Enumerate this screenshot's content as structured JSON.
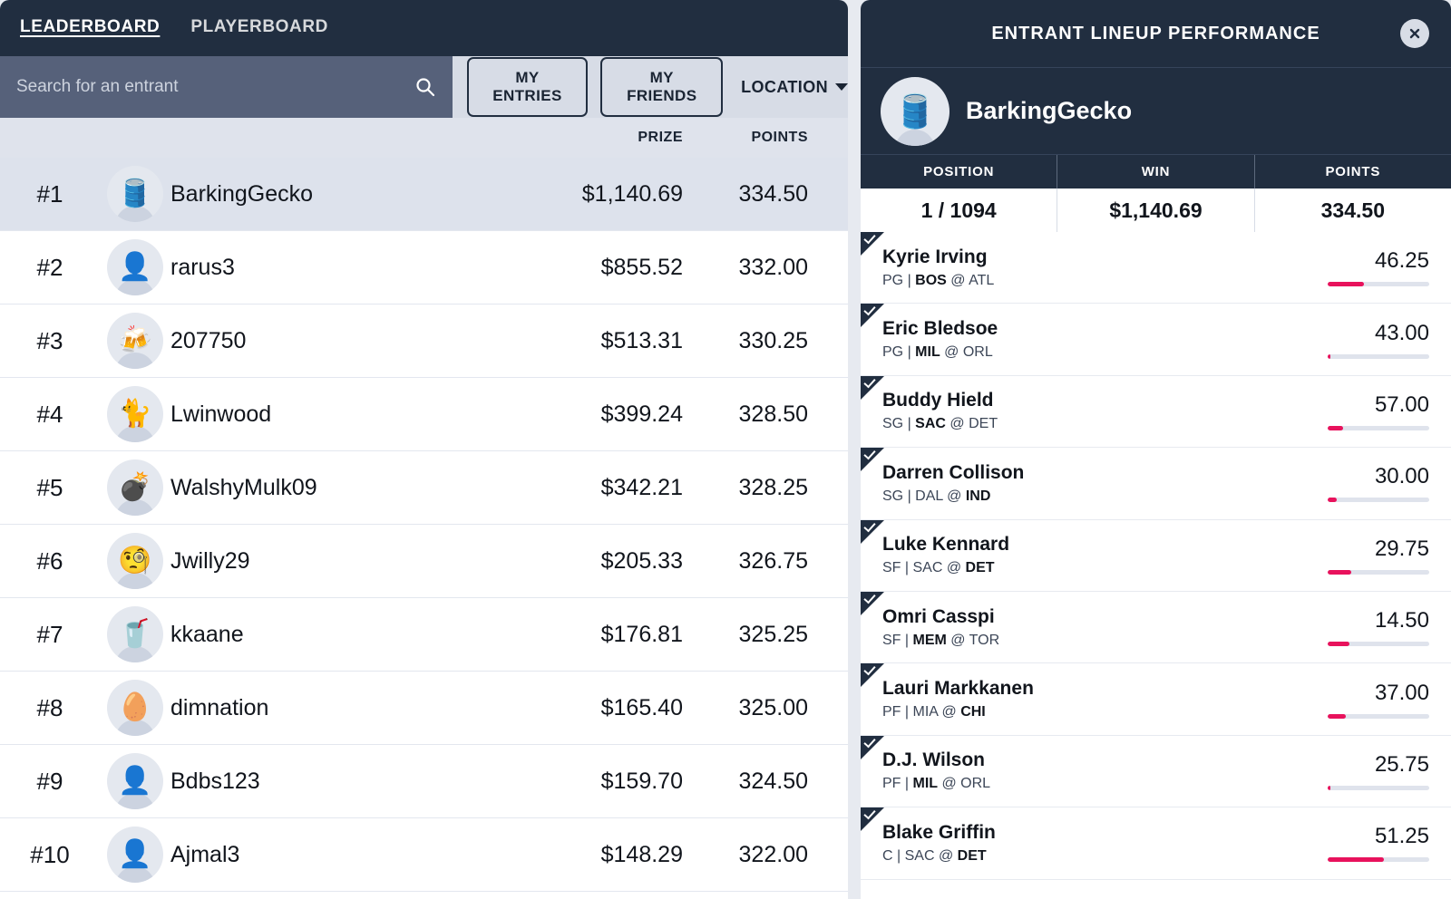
{
  "leaderboard": {
    "tabs": [
      {
        "label": "LEADERBOARD",
        "active": true
      },
      {
        "label": "PLAYERBOARD",
        "active": false
      }
    ],
    "search": {
      "placeholder": "Search for an entrant",
      "value": ""
    },
    "filters": {
      "my_entries": "MY ENTRIES",
      "my_friends": "MY FRIENDS",
      "location": "LOCATION"
    },
    "columns": {
      "prize": "PRIZE",
      "points": "POINTS"
    },
    "rows": [
      {
        "rank": "#1",
        "name": "BarkingGecko",
        "prize": "$1,140.69",
        "points": "334.50",
        "avatar": "oil-drum-avatar",
        "emoji": "🛢️",
        "selected": true
      },
      {
        "rank": "#2",
        "name": "rarus3",
        "prize": "$855.52",
        "points": "332.00",
        "avatar": "photo-avatar",
        "emoji": "👤",
        "selected": false
      },
      {
        "rank": "#3",
        "name": "207750",
        "prize": "$513.31",
        "points": "330.25",
        "avatar": "beer-mugs-avatar",
        "emoji": "🍻",
        "selected": false
      },
      {
        "rank": "#4",
        "name": "Lwinwood",
        "prize": "$399.24",
        "points": "328.50",
        "avatar": "animal-photo-avatar",
        "emoji": "🐈",
        "selected": false
      },
      {
        "rank": "#5",
        "name": "WalshyMulk09",
        "prize": "$342.21",
        "points": "328.25",
        "avatar": "bomb-avatar",
        "emoji": "💣",
        "selected": false
      },
      {
        "rank": "#6",
        "name": "Jwilly29",
        "prize": "$205.33",
        "points": "326.75",
        "avatar": "monocle-face-avatar",
        "emoji": "🧐",
        "selected": false
      },
      {
        "rank": "#7",
        "name": "kkaane",
        "prize": "$176.81",
        "points": "325.25",
        "avatar": "cup-straw-avatar",
        "emoji": "🥤",
        "selected": false
      },
      {
        "rank": "#8",
        "name": "dimnation",
        "prize": "$165.40",
        "points": "325.00",
        "avatar": "egg-avatar",
        "emoji": "🥚",
        "selected": false
      },
      {
        "rank": "#9",
        "name": "Bdbs123",
        "prize": "$159.70",
        "points": "324.50",
        "avatar": "person-dark-avatar",
        "emoji": "👤",
        "selected": false
      },
      {
        "rank": "#10",
        "name": "Ajmal3",
        "prize": "$148.29",
        "points": "322.00",
        "avatar": "photo-avatar",
        "emoji": "👤",
        "selected": false
      }
    ]
  },
  "panel": {
    "title": "ENTRANT LINEUP PERFORMANCE",
    "close_label": "×",
    "entrant": {
      "name": "BarkingGecko",
      "avatar": "oil-drum-avatar",
      "emoji": "🛢️"
    },
    "stats": {
      "headers": [
        "POSITION",
        "WIN",
        "POINTS"
      ],
      "values": [
        "1 / 1094",
        "$1,140.69",
        "334.50"
      ]
    },
    "accent_color": "#e8125c",
    "players": [
      {
        "name": "Kyrie Irving",
        "position": "PG",
        "away": "BOS",
        "home": "ATL",
        "bold_team": "BOS",
        "meta": "PG | BOS @ ATL",
        "score": "46.25",
        "bar_pct": 36,
        "checked": true
      },
      {
        "name": "Eric Bledsoe",
        "position": "PG",
        "away": "MIL",
        "home": "ORL",
        "bold_team": "MIL",
        "meta": "PG | MIL @ ORL",
        "score": "43.00",
        "bar_pct": 3,
        "checked": true
      },
      {
        "name": "Buddy Hield",
        "position": "SG",
        "away": "SAC",
        "home": "DET",
        "bold_team": "SAC",
        "meta": "SG | SAC @ DET",
        "score": "57.00",
        "bar_pct": 15,
        "checked": true
      },
      {
        "name": "Darren Collison",
        "position": "SG",
        "away": "DAL",
        "home": "IND",
        "bold_team": "IND",
        "meta": "SG | DAL @ IND",
        "score": "30.00",
        "bar_pct": 9,
        "checked": true
      },
      {
        "name": "Luke Kennard",
        "position": "SF",
        "away": "SAC",
        "home": "DET",
        "bold_team": "DET",
        "meta": "SF | SAC @ DET",
        "score": "29.75",
        "bar_pct": 23,
        "checked": true
      },
      {
        "name": "Omri Casspi",
        "position": "SF",
        "away": "MEM",
        "home": "TOR",
        "bold_team": "MEM",
        "meta": "SF | MEM @ TOR",
        "score": "14.50",
        "bar_pct": 21,
        "checked": true
      },
      {
        "name": "Lauri Markkanen",
        "position": "PF",
        "away": "MIA",
        "home": "CHI",
        "bold_team": "CHI",
        "meta": "PF | MIA @ CHI",
        "score": "37.00",
        "bar_pct": 18,
        "checked": true
      },
      {
        "name": "D.J. Wilson",
        "position": "PF",
        "away": "MIL",
        "home": "ORL",
        "bold_team": "MIL",
        "meta": "PF | MIL @ ORL",
        "score": "25.75",
        "bar_pct": 3,
        "checked": true
      },
      {
        "name": "Blake Griffin",
        "position": "C",
        "away": "SAC",
        "home": "DET",
        "bold_team": "DET",
        "meta": "C | SAC @ DET",
        "score": "51.25",
        "bar_pct": 55,
        "checked": true
      }
    ]
  }
}
